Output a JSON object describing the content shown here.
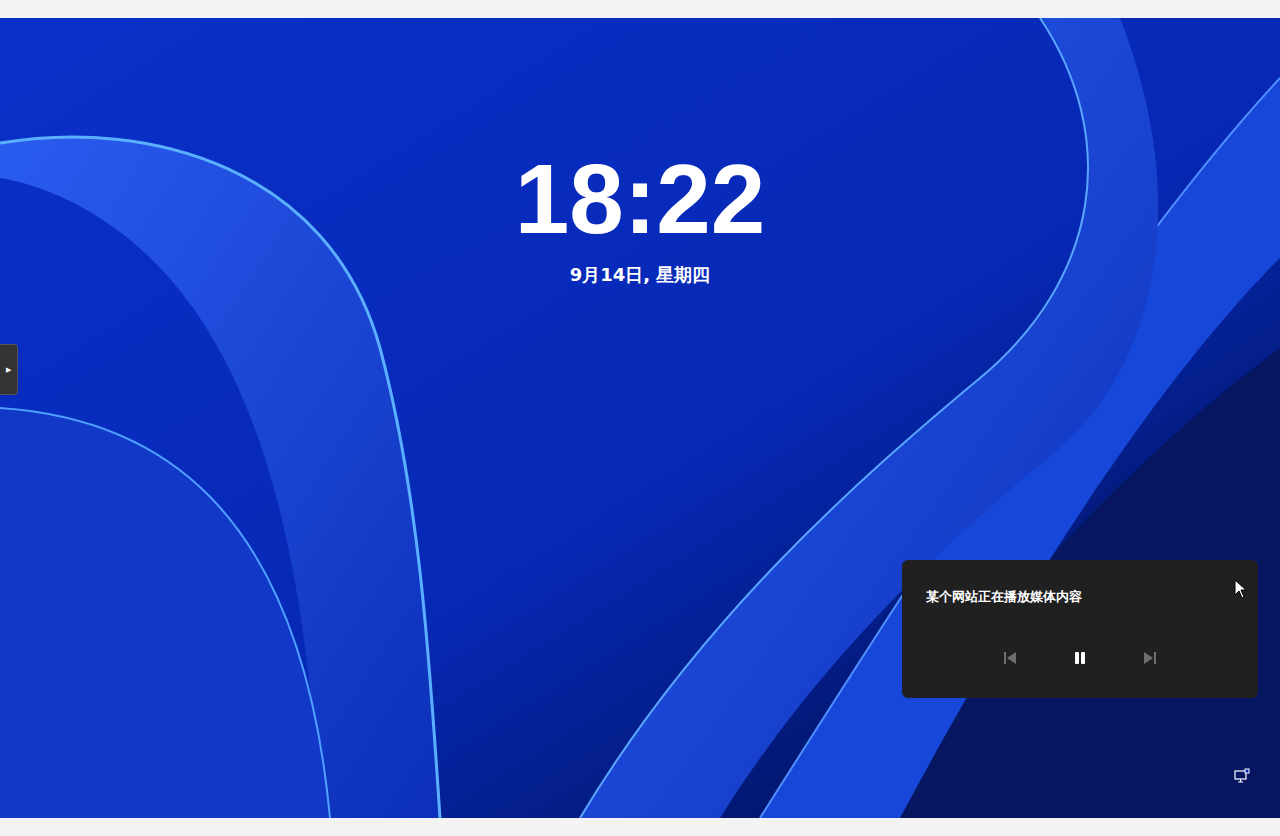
{
  "clock": {
    "time": "18:22",
    "date": "9月14日, 星期四"
  },
  "side_tab": {
    "icon": "▶"
  },
  "media": {
    "title": "某个网站正在播放媒体内容",
    "playing": true,
    "controls": [
      {
        "kind": "previous",
        "disabled": true
      },
      {
        "kind": "playpause",
        "disabled": false
      },
      {
        "kind": "next",
        "disabled": true
      }
    ]
  }
}
